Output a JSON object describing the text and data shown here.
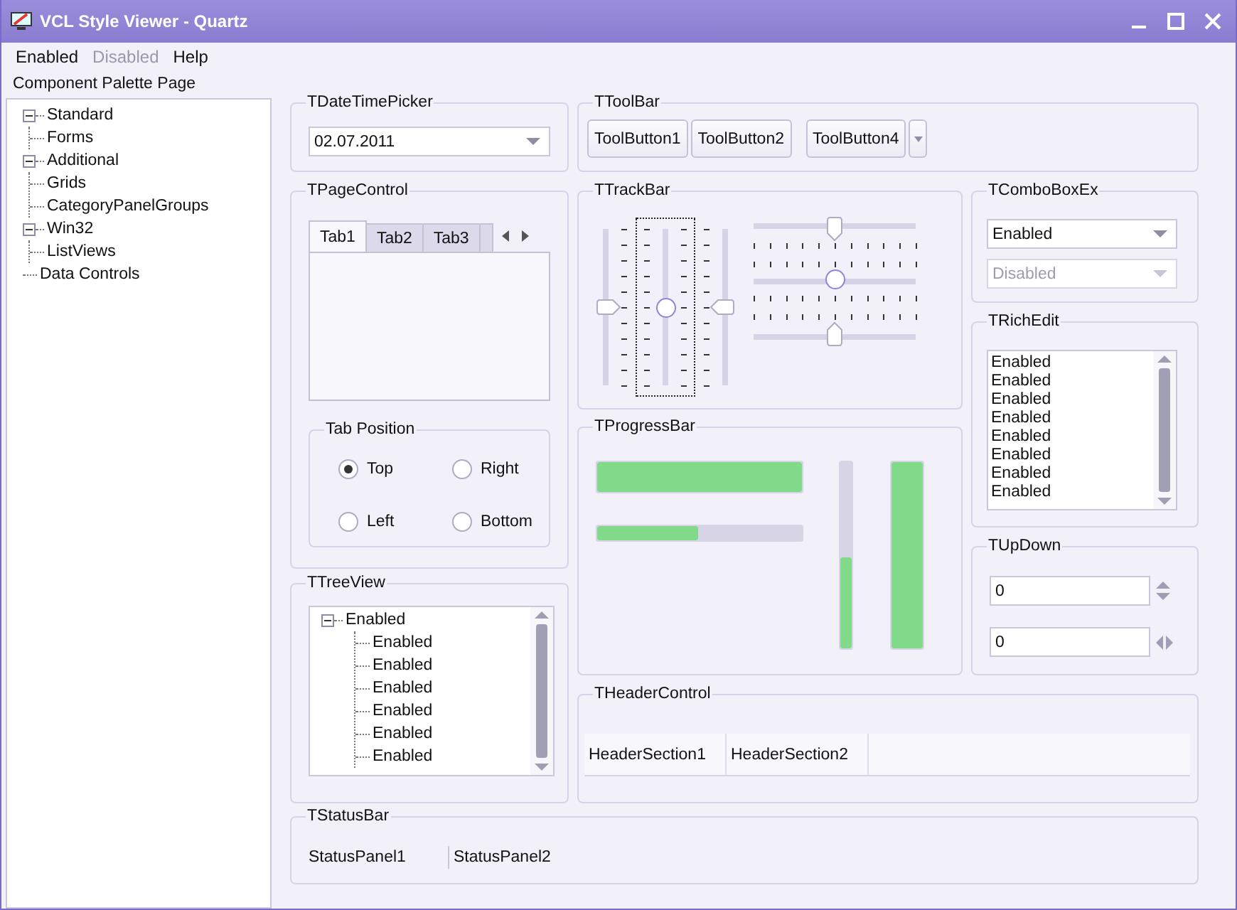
{
  "window": {
    "title": "VCL Style Viewer - Quartz"
  },
  "menu": [
    {
      "label": "Enabled",
      "disabled": false
    },
    {
      "label": "Disabled",
      "disabled": true
    },
    {
      "label": "Help",
      "disabled": false
    }
  ],
  "palette": {
    "label": "Component Palette Page",
    "items": [
      {
        "label": "Standard",
        "expanded": true,
        "children": [
          {
            "label": "Forms"
          }
        ]
      },
      {
        "label": "Additional",
        "expanded": true,
        "children": [
          {
            "label": "Grids"
          },
          {
            "label": "CategoryPanelGroups"
          }
        ]
      },
      {
        "label": "Win32",
        "expanded": true,
        "children": [
          {
            "label": "ListViews"
          }
        ]
      },
      {
        "label": "Data Controls"
      }
    ]
  },
  "date_time_picker": {
    "title": "TDateTimePicker",
    "value": "02.07.2011"
  },
  "toolbar": {
    "title": "TToolBar",
    "buttons": [
      {
        "kind": "button",
        "label": "ToolButton1"
      },
      {
        "kind": "button",
        "label": "ToolButton2"
      },
      {
        "kind": "separator"
      },
      {
        "kind": "dropdown",
        "label": "ToolButton4"
      }
    ]
  },
  "page_control": {
    "title": "TPageControl",
    "tabs": [
      {
        "label": "Tab1",
        "selected": true
      },
      {
        "label": "Tab2",
        "selected": false
      },
      {
        "label": "Tab3",
        "selected": false
      }
    ],
    "tab_position": {
      "title": "Tab Position",
      "options": [
        {
          "label": "Top",
          "selected": true
        },
        {
          "label": "Right",
          "selected": false
        },
        {
          "label": "Left",
          "selected": false
        },
        {
          "label": "Bottom",
          "selected": false
        }
      ]
    }
  },
  "track_bar": {
    "title": "TTrackBar",
    "vertical": [
      {
        "kind": "right",
        "focused": false,
        "level": 0.5
      },
      {
        "kind": "both",
        "focused": true,
        "level": 0.5
      },
      {
        "kind": "left",
        "focused": false,
        "level": 0.5
      }
    ],
    "horizontal": [
      {
        "kind": "bottom",
        "level": 0.5
      },
      {
        "kind": "both",
        "level": 0.5
      },
      {
        "kind": "top",
        "level": 0.5
      }
    ]
  },
  "combo_box_ex": {
    "title": "TComboBoxEx",
    "boxes": [
      {
        "value": "Enabled",
        "disabled": false
      },
      {
        "value": "Disabled",
        "disabled": true
      }
    ]
  },
  "rich_edit": {
    "title": "TRichEdit",
    "lines": [
      "Enabled",
      "Enabled",
      "Enabled",
      "Enabled",
      "Enabled",
      "Enabled",
      "Enabled",
      "Enabled"
    ]
  },
  "progress_bar": {
    "title": "TProgressBar",
    "bars": [
      {
        "kind": "horizontal",
        "level": 1
      },
      {
        "kind": "horizontal",
        "level": 0.5
      },
      {
        "kind": "vertical",
        "level": 0.5
      },
      {
        "kind": "vertical",
        "level": 1
      }
    ]
  },
  "up_down": {
    "title": "TUpDown",
    "fields": [
      {
        "value": "0",
        "kind": "vertical"
      },
      {
        "value": "0",
        "kind": "horizontal"
      }
    ]
  },
  "tree_view": {
    "title": "TTreeView",
    "items": [
      {
        "label": "Enabled",
        "expanded": true,
        "children": [
          {
            "label": "Enabled"
          },
          {
            "label": "Enabled"
          },
          {
            "label": "Enabled"
          },
          {
            "label": "Enabled"
          },
          {
            "label": "Enabled"
          },
          {
            "label": "Enabled"
          }
        ]
      }
    ]
  },
  "header_control": {
    "title": "THeaderControl",
    "sections": [
      "HeaderSection1",
      "HeaderSection2"
    ]
  },
  "status_bar": {
    "title": "TStatusBar",
    "panels": [
      "StatusPanel1",
      "StatusPanel2"
    ]
  }
}
